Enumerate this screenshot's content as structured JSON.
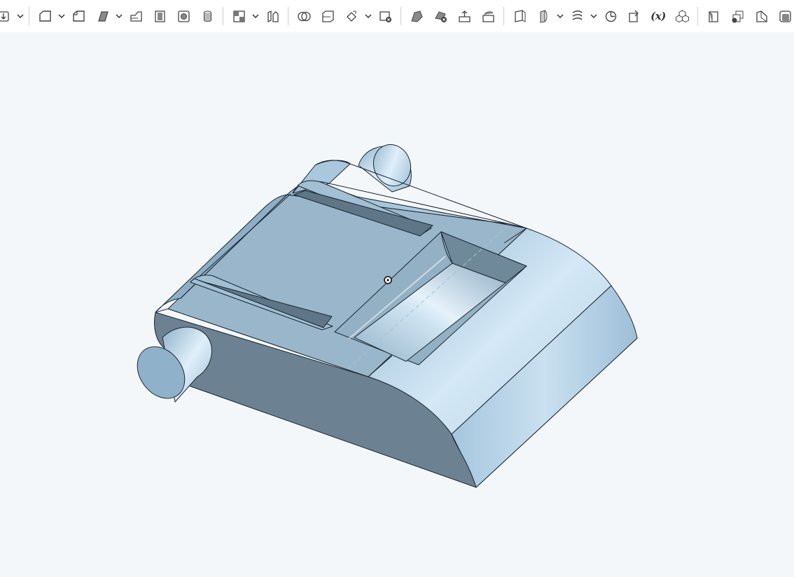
{
  "toolbar": {
    "groups": [
      [
        {
          "name": "import-icon",
          "caret": true
        }
      ],
      [
        {
          "name": "sketch-icon",
          "caret": true
        },
        {
          "name": "extrude-icon",
          "caret": false
        },
        {
          "name": "revolve-icon",
          "caret": true
        },
        {
          "name": "sweep-icon",
          "caret": false
        },
        {
          "name": "loft-icon",
          "caret": false
        },
        {
          "name": "thicken-icon",
          "caret": false
        },
        {
          "name": "enclose-icon",
          "caret": false
        }
      ],
      [
        {
          "name": "fillet-icon",
          "caret": true
        },
        {
          "name": "chamfer-icon",
          "caret": false
        }
      ],
      [
        {
          "name": "boolean-icon",
          "caret": false
        },
        {
          "name": "split-icon",
          "caret": false
        },
        {
          "name": "transform-icon",
          "caret": true
        },
        {
          "name": "delete-part-icon",
          "caret": false
        }
      ],
      [
        {
          "name": "modify-fillet-icon",
          "caret": false
        },
        {
          "name": "delete-face-icon",
          "caret": false
        },
        {
          "name": "move-face-icon",
          "caret": false
        },
        {
          "name": "replace-face-icon",
          "caret": false
        }
      ],
      [
        {
          "name": "plane-icon",
          "caret": false
        },
        {
          "name": "mate-connector-icon",
          "caret": true
        },
        {
          "name": "helix-icon",
          "caret": true
        },
        {
          "name": "measure-icon",
          "caret": false
        },
        {
          "name": "derived-icon",
          "caret": false
        },
        {
          "name": "variable-icon",
          "label": "(x)",
          "caret": false
        },
        {
          "name": "pattern-icon",
          "caret": false
        }
      ],
      [
        {
          "name": "sheet-metal-icon",
          "caret": false
        },
        {
          "name": "finish-sheet-metal-icon",
          "caret": false
        },
        {
          "name": "flange-icon",
          "caret": false
        },
        {
          "name": "tab-icon",
          "caret": false
        },
        {
          "name": "more-icon",
          "caret": false
        }
      ]
    ]
  },
  "viewport": {
    "background": "#f4f7fa",
    "model_name": "3d-part-model",
    "colors": {
      "top_face": "#9ab6cb",
      "side_dark": "#6b8191",
      "side_light": "#b8d3e6",
      "edge": "#1a2630",
      "slot": "#657c8d"
    }
  }
}
